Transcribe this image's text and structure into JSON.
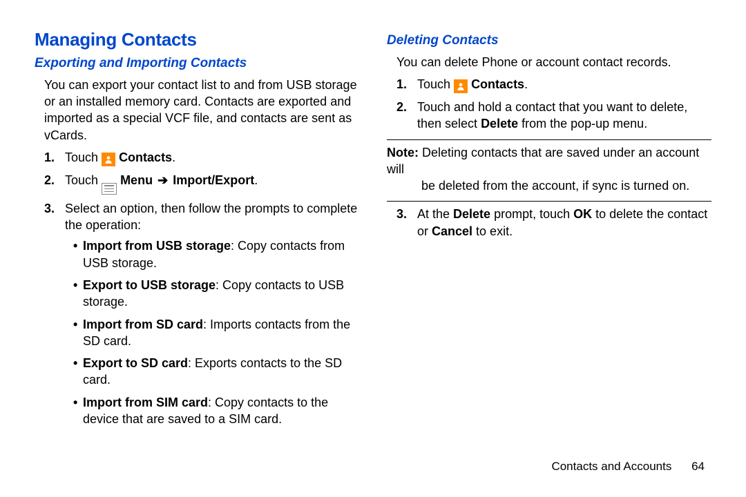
{
  "left": {
    "h1": "Managing Contacts",
    "h2": "Exporting and Importing Contacts",
    "intro": "You can export your contact list to and from USB storage or an installed memory card. Contacts are exported and imported as a special VCF file, and contacts are sent as vCards.",
    "step1_pre": "Touch ",
    "step1_bold": "Contacts",
    "step1_post": ".",
    "step2_pre": "Touch ",
    "step2_menu": "Menu",
    "step2_arrow": "➔",
    "step2_ie": "Import/Export",
    "step2_post": ".",
    "step3": "Select an option, then follow the prompts to complete the operation:",
    "b1_bold": "Import from USB storage",
    "b1_r": ": Copy contacts from USB storage.",
    "b2_bold": "Export to USB storage",
    "b2_r": ": Copy contacts to USB storage.",
    "b3_bold": "Import from SD card",
    "b3_r": ": Imports contacts from the SD card.",
    "b4_bold": "Export to SD card",
    "b4_r": ": Exports contacts to the SD card.",
    "b5_bold": "Import from SIM card",
    "b5_r": ": Copy contacts to the device that are saved to a SIM card."
  },
  "right": {
    "h2": "Deleting Contacts",
    "intro": "You can delete Phone or account contact records.",
    "step1_pre": "Touch ",
    "step1_bold": "Contacts",
    "step1_post": ".",
    "step2_a": "Touch and hold a contact that you want to delete, then select ",
    "step2_b": "Delete",
    "step2_c": " from the pop-up menu.",
    "note_label": "Note:",
    "note_line1": " Deleting contacts that are saved under an account will",
    "note_line2": "be deleted from the account, if sync is turned on.",
    "step3_a": "At the ",
    "step3_b": "Delete",
    "step3_c": " prompt, touch ",
    "step3_d": "OK",
    "step3_e": " to delete the contact or ",
    "step3_f": "Cancel",
    "step3_g": " to exit."
  },
  "footer": {
    "section": "Contacts and Accounts",
    "page": "64"
  }
}
